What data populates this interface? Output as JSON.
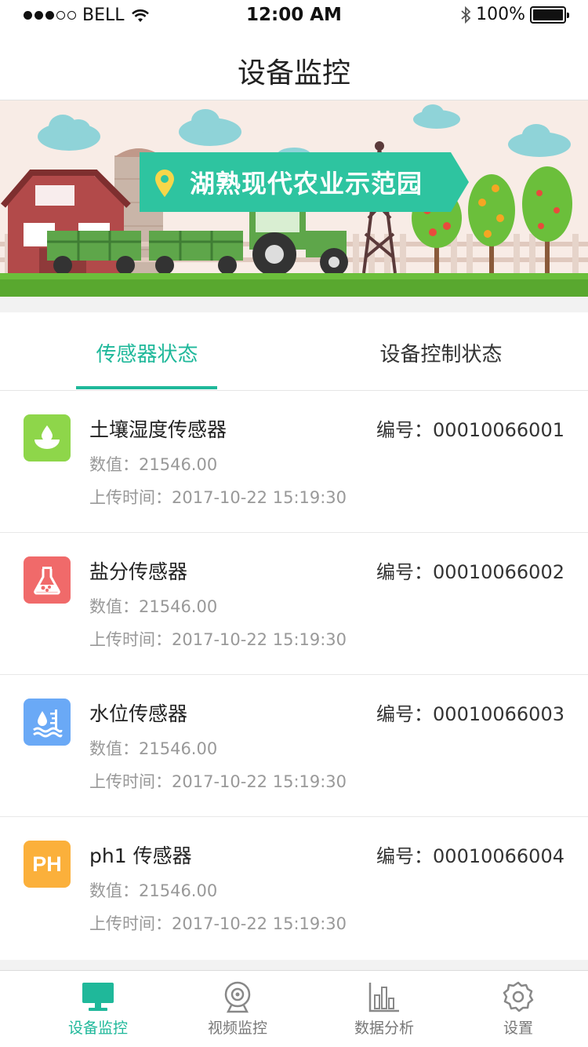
{
  "status_bar": {
    "carrier": "BELL",
    "time": "12:00 AM",
    "battery": "100%"
  },
  "nav": {
    "title": "设备监控"
  },
  "banner": {
    "label": "湖熟现代农业示范园"
  },
  "tabs": [
    {
      "label": "传感器状态",
      "active": true
    },
    {
      "label": "设备控制状态",
      "active": false
    }
  ],
  "sensors": [
    {
      "name": "土壤湿度传感器",
      "value": "数值：21546.00",
      "time": "上传时间：2017-10-22  15:19:30",
      "code": "编号：00010066001",
      "icon": "soil-moisture-icon",
      "color": "#8ed64a"
    },
    {
      "name": "盐分传感器",
      "value": "数值：21546.00",
      "time": "上传时间：2017-10-22  15:19:30",
      "code": "编号：00010066002",
      "icon": "salinity-flask-icon",
      "color": "#f06a6a"
    },
    {
      "name": "水位传感器",
      "value": "数值：21546.00",
      "time": "上传时间：2017-10-22  15:19:30",
      "code": "编号：00010066003",
      "icon": "water-level-icon",
      "color": "#6aa9f6"
    },
    {
      "name": "ph1 传感器",
      "value": "数值：21546.00",
      "time": "上传时间：2017-10-22  15:19:30",
      "code": "编号：00010066004",
      "icon": "ph-icon",
      "icon_text": "PH",
      "color": "#fbb03b"
    }
  ],
  "tabbar": [
    {
      "label": "设备监控",
      "icon": "monitor-icon",
      "active": true
    },
    {
      "label": "视频监控",
      "icon": "webcam-icon",
      "active": false
    },
    {
      "label": "数据分析",
      "icon": "bar-chart-icon",
      "active": false
    },
    {
      "label": "设置",
      "icon": "gear-icon",
      "active": false
    }
  ],
  "colors": {
    "accent": "#1fb89a",
    "grey_text": "#999999"
  }
}
